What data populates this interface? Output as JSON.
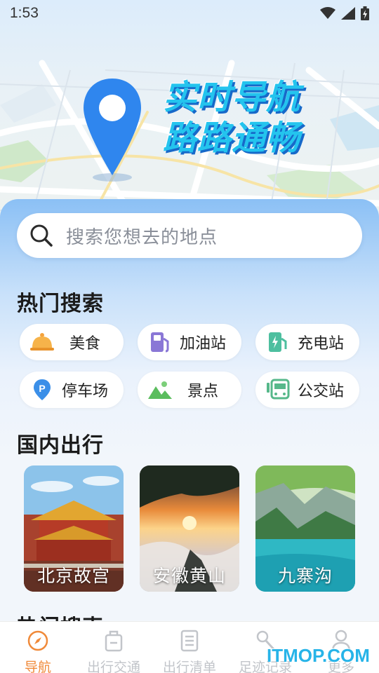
{
  "status": {
    "time": "1:53"
  },
  "hero": {
    "line1": "实时导航",
    "line2": "路路通畅"
  },
  "search": {
    "placeholder": "搜索您想去的地点"
  },
  "hot_search": {
    "title": "热门搜索",
    "items": [
      {
        "label": "美食",
        "icon": "food-cloche-icon"
      },
      {
        "label": "加油站",
        "icon": "gas-station-icon"
      },
      {
        "label": "充电站",
        "icon": "charging-station-icon"
      },
      {
        "label": "停车场",
        "icon": "parking-icon"
      },
      {
        "label": "景点",
        "icon": "scenic-mountain-icon"
      },
      {
        "label": "公交站",
        "icon": "bus-icon"
      }
    ]
  },
  "domestic_travel": {
    "title": "国内出行",
    "items": [
      {
        "label": "北京故宫"
      },
      {
        "label": "安徽黄山"
      },
      {
        "label": "九寨沟"
      }
    ]
  },
  "next_section": {
    "title": "热门搜索"
  },
  "nav": {
    "items": [
      {
        "label": "导航",
        "icon": "compass-icon",
        "active": true
      },
      {
        "label": "出行交通",
        "icon": "luggage-icon",
        "active": false
      },
      {
        "label": "出行清单",
        "icon": "checklist-icon",
        "active": false
      },
      {
        "label": "足迹记录",
        "icon": "footprint-icon",
        "active": false
      },
      {
        "label": "更多",
        "icon": "profile-icon",
        "active": false
      }
    ]
  },
  "watermark": "ITMOP.COM",
  "colors": {
    "accent": "#f08a3a",
    "pin": "#2f86ee",
    "title": "#24c4ee"
  }
}
